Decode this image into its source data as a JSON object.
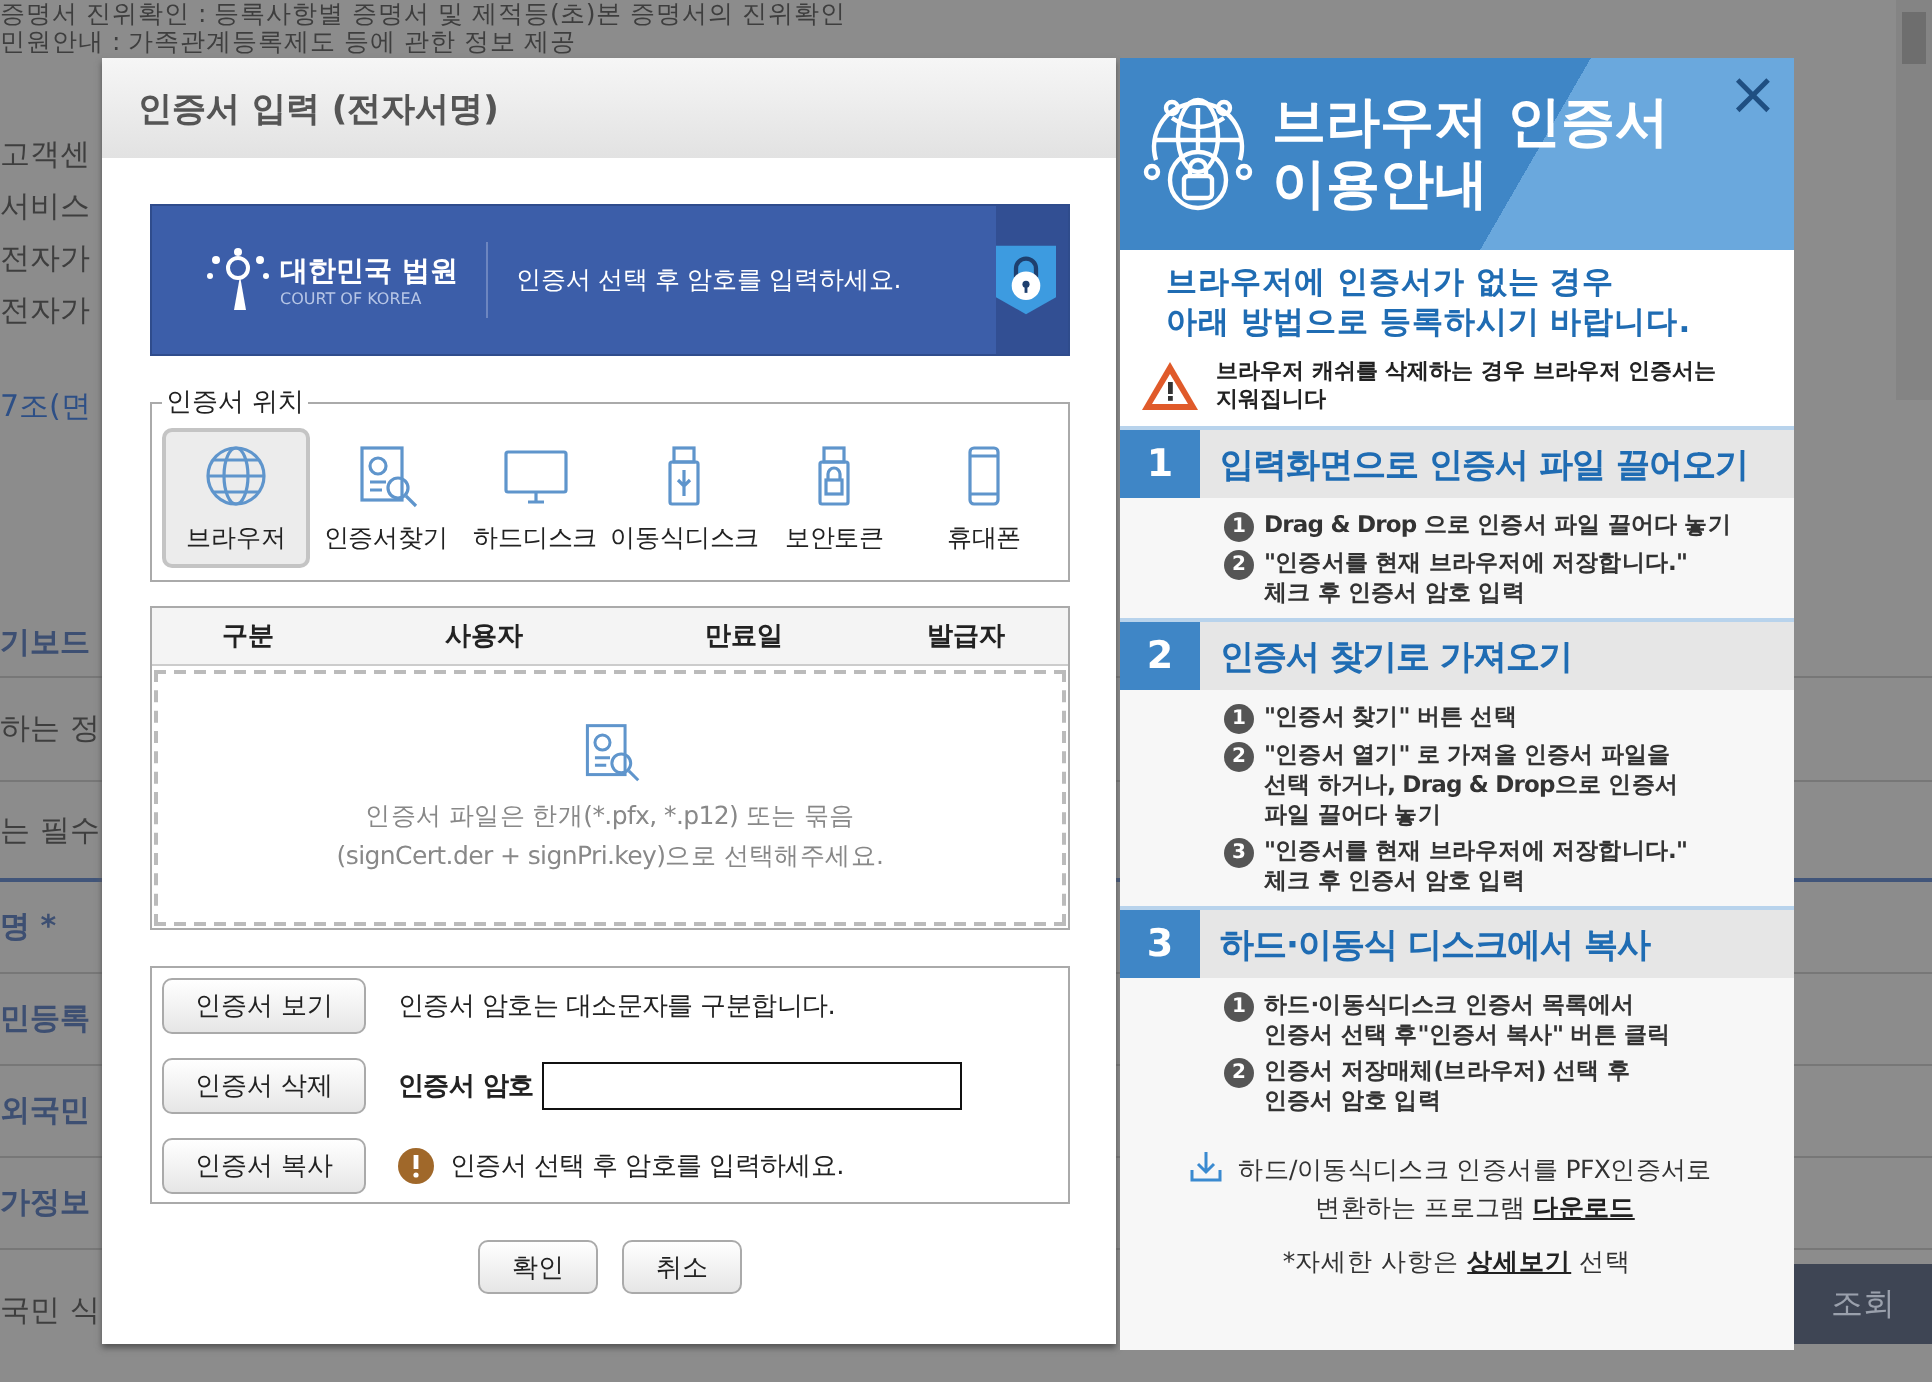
{
  "background_page": {
    "top_lines": [
      "증명서 진위확인 : 등록사항별 증명서 및 제적등(초)본 증명서의 진위확인",
      "민원안내 : 가족관계등록제도 등에 관한 정보 제공",
      "고객센",
      "서비스",
      "전자가",
      "전자가"
    ],
    "link": "7조(면",
    "form_rows": [
      {
        "text": "기보드",
        "kind": "label"
      },
      {
        "text": "하는 정",
        "kind": "plain"
      },
      {
        "text": "는 필수",
        "kind": "plain"
      },
      {
        "text": "명 *",
        "kind": "label"
      },
      {
        "text": "민등록",
        "kind": "label"
      },
      {
        "text": "외국민",
        "kind": "label"
      },
      {
        "text": "가정보",
        "kind": "label"
      },
      {
        "text": "국민 식",
        "kind": "plain"
      }
    ],
    "search_button": "조회"
  },
  "dialog": {
    "title": "인증서 입력 (전자서명)",
    "banner": {
      "logo_name": "대한민국 법원",
      "logo_sub": "COURT OF KOREA",
      "message": "인증서 선택 후 암호를 입력하세요."
    },
    "location": {
      "legend": "인증서 위치",
      "options": [
        {
          "label": "브라우저",
          "kind": "globe",
          "selected": true
        },
        {
          "label": "인증서찾기",
          "kind": "search",
          "selected": false
        },
        {
          "label": "하드디스크",
          "kind": "monitor",
          "selected": false
        },
        {
          "label": "이동식디스크",
          "kind": "usb",
          "selected": false
        },
        {
          "label": "보안토큰",
          "kind": "token",
          "selected": false
        },
        {
          "label": "휴대폰",
          "kind": "phone",
          "selected": false
        }
      ]
    },
    "table": {
      "columns": [
        "구분",
        "사용자",
        "만료일",
        "발급자"
      ],
      "drop_hint": [
        "인증서 파일은 한개(*.pfx, *.p12) 또는 묶음",
        "(signCert.der + signPri.key)으로 선택해주세요."
      ]
    },
    "actions": [
      {
        "button": "인증서 보기",
        "kind": "note",
        "text": "인증서 암호는 대소문자를 구분합니다."
      },
      {
        "button": "인증서 삭제",
        "kind": "password",
        "text": "인증서 암호"
      },
      {
        "button": "인증서 복사",
        "kind": "warning",
        "text": "인증서 선택 후 암호를 입력하세요."
      }
    ],
    "buttons": [
      "확인",
      "취소"
    ]
  },
  "guide": {
    "title_lines": [
      "브라우저 인증서",
      "이용안내"
    ],
    "close": "×",
    "subtitle_lines": [
      "브라우저에 인증서가 없는 경우",
      "아래 방법으로 등록하시기 바랍니다."
    ],
    "warning": [
      "브라우저 캐쉬를 삭제하는 경우 브라우저 인증서는",
      "지워집니다"
    ],
    "sections": [
      {
        "number": "1",
        "title": "입력화면으로 인증서 파일 끌어오기",
        "steps": [
          {
            "number": "1",
            "lines": [
              "Drag & Drop 으로 인증서 파일 끌어다 놓기"
            ]
          },
          {
            "number": "2",
            "lines": [
              "\"인증서를 현재 브라우저에 저장합니다.\"",
              "체크 후 인증서 암호 입력"
            ]
          }
        ]
      },
      {
        "number": "2",
        "title": "인증서 찾기로 가져오기",
        "steps": [
          {
            "number": "1",
            "lines": [
              "\"인증서 찾기\" 버튼 선택"
            ]
          },
          {
            "number": "2",
            "lines": [
              "\"인증서 열기\" 로 가져올 인증서 파일을",
              "선택 하거나, Drag & Drop으로 인증서",
              "파일 끌어다 놓기"
            ]
          },
          {
            "number": "3",
            "lines": [
              "\"인증서를 현재 브라우저에 저장합니다.\"",
              "체크 후 인증서 암호 입력"
            ]
          }
        ]
      },
      {
        "number": "3",
        "title": "하드·이동식 디스크에서 복사",
        "steps": [
          {
            "number": "1",
            "lines": [
              "하드·이동식디스크 인증서 목록에서",
              "인증서 선택 후\"인증서 복사\" 버튼 클릭"
            ]
          },
          {
            "number": "2",
            "lines": [
              "인증서 저장매체(브라우저) 선택 후",
              "인증서 암호 입력"
            ]
          }
        ]
      }
    ],
    "download": {
      "text": "하드/이동식디스크 인증서를 PFX인증서로 변환하는 프로그램",
      "link": "다운로드"
    },
    "detail": {
      "before": "*자세한 사항은",
      "link": "상세보기",
      "after": "선택"
    }
  }
}
